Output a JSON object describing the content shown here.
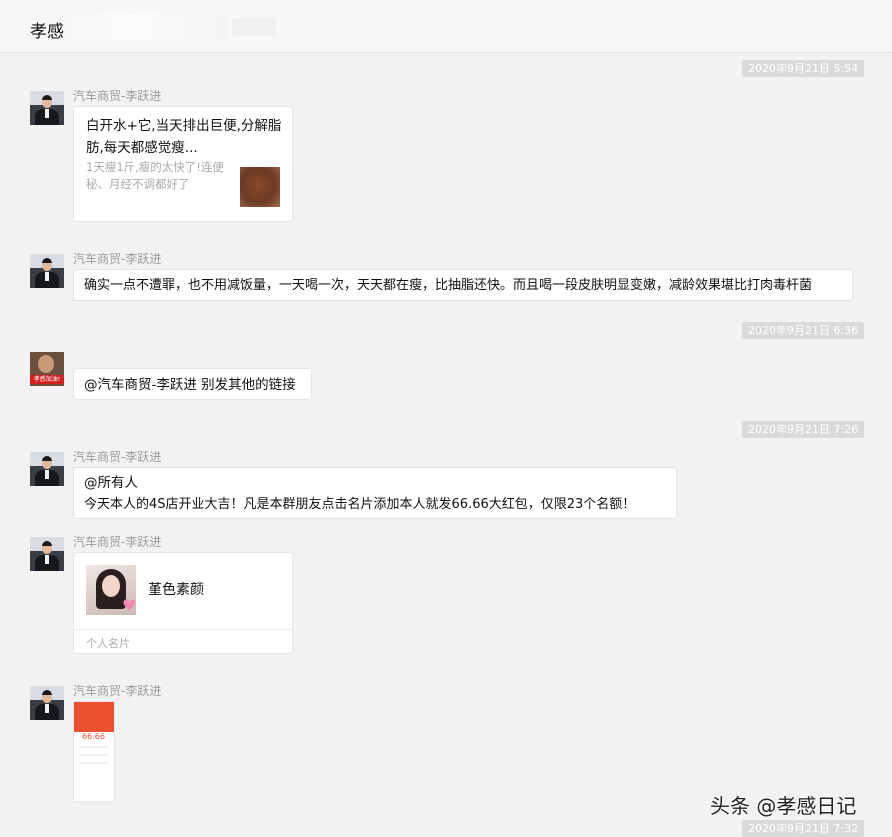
{
  "window": {
    "title": "孝感"
  },
  "messages": [
    {
      "time": "2020年9月21日 5:54",
      "sender": "汽车商贸-李跃进",
      "link": {
        "title": "白开水+它,当天排出巨便,分解脂肪,每天都感觉瘦...",
        "desc": "1天瘦1斤,瘦的太快了!连便秘、月经不调都好了"
      }
    },
    {
      "sender": "汽车商贸-李跃进",
      "text": "确实一点不遭罪，也不用减饭量，一天喝一次，天天都在瘦，比抽脂还快。而且喝一段皮肤明显变嫩，减龄效果堪比打肉毒杆菌"
    },
    {
      "time": "2020年9月21日 6:36",
      "avatar_text": "孝感加油!",
      "text": "@汽车商贸-李跃进 别发其他的链接"
    },
    {
      "time": "2020年9月21日 7:26",
      "sender": "汽车商贸-李跃进",
      "text_line1": "@所有人",
      "text_line2": "今天本人的4S店开业大吉！凡是本群朋友点击名片添加本人就发66.66大红包，仅限23个名额！"
    },
    {
      "sender": "汽车商贸-李跃进",
      "card": {
        "name": "堇色素颜",
        "footer": "个人名片"
      }
    },
    {
      "sender": "汽车商贸-李跃进",
      "image_amount": "66.66"
    },
    {
      "time": "2020年9月21日 7:32"
    }
  ],
  "watermark": "头条 @孝感日记"
}
